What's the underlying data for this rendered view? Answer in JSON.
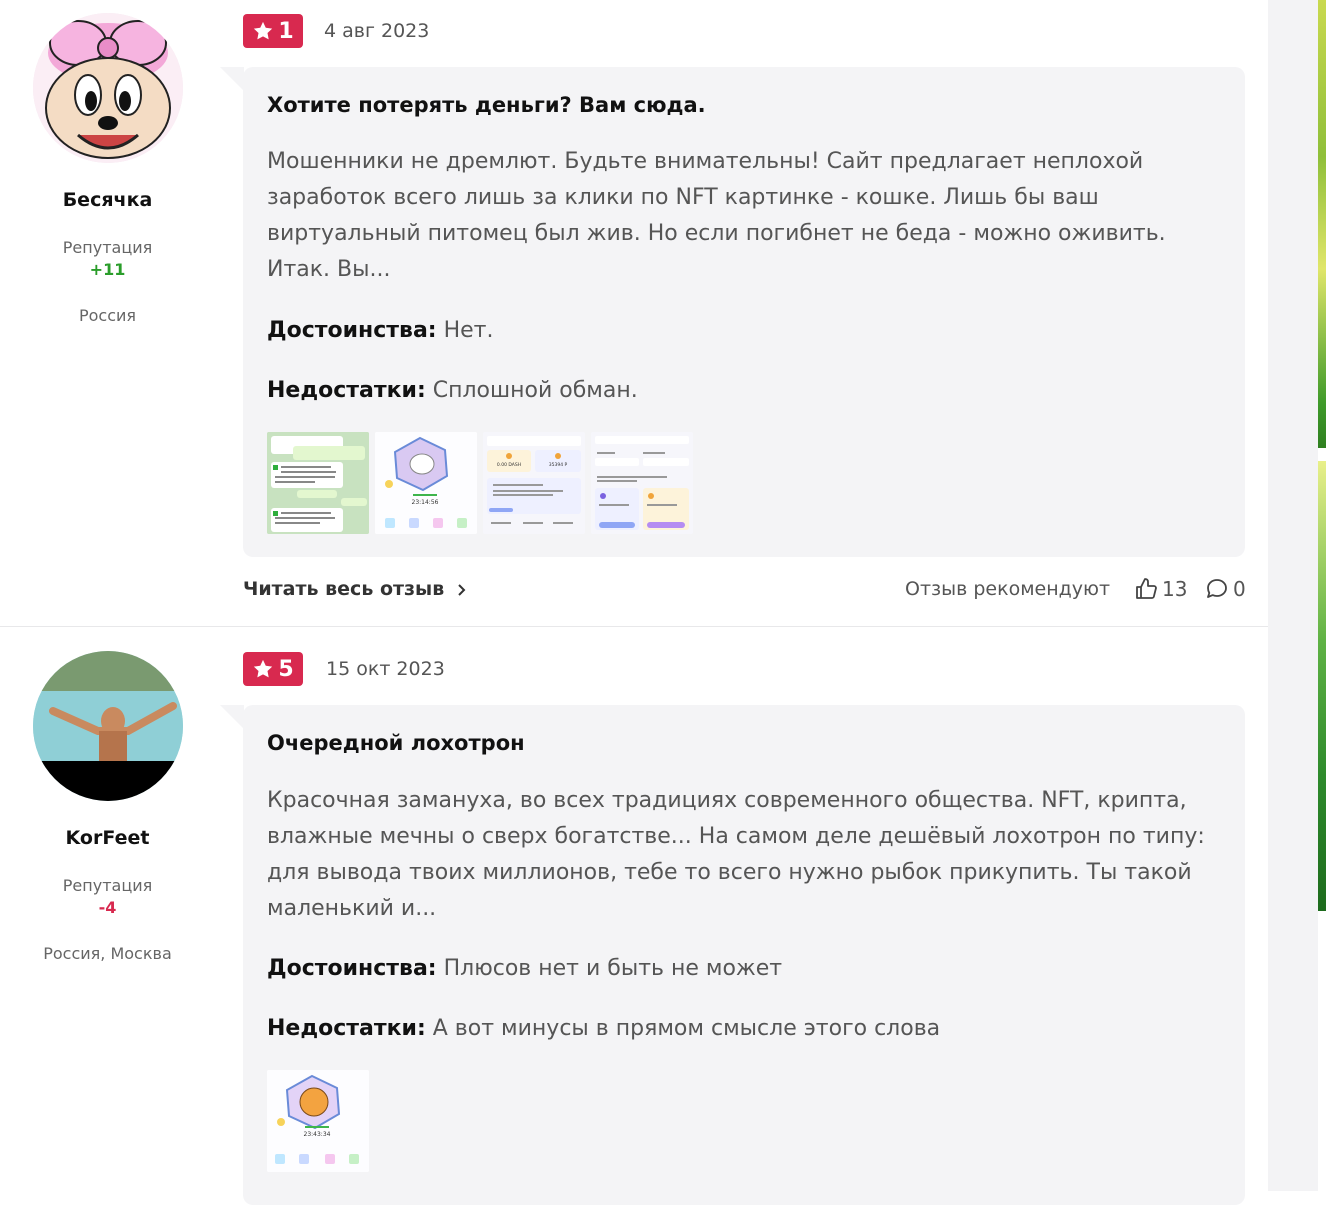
{
  "reviews": [
    {
      "author": {
        "name": "Бесячка",
        "reputation_label": "Репутация",
        "reputation_value": "+11",
        "reputation_color": "#2a9d2a",
        "location": "Россия"
      },
      "rating": "1",
      "date": "4 авг 2023",
      "title": "Хотите потерять деньги? Вам сюда.",
      "text": "Мошенники не дремлют. Будьте внимательны! Сайт предлагает неплохой заработок всего лишь за клики по NFT картинке - кошке. Лишь бы ваш виртуальный питомец был жив. Но если погибнет не беда - можно оживить. Итак. Вы...",
      "pros_label": "Достоинства:",
      "pros": "Нет.",
      "cons_label": "Недостатки:",
      "cons": "Сплошной обман.",
      "thumb_1_time": "23:14:56",
      "thumb_2_amounts": [
        "0.00 DASH",
        "35394 P"
      ],
      "read_more": "Читать весь отзыв",
      "recommend": "Отзыв рекомендуют",
      "likes": "13",
      "comments": "0"
    },
    {
      "author": {
        "name": "KorFeet",
        "reputation_label": "Репутация",
        "reputation_value": "-4",
        "reputation_color": "#d8294f",
        "location": "Россия, Москва"
      },
      "rating": "5",
      "date": "15 окт 2023",
      "title": "Очередной лохотрон",
      "text": "Красочная замануха, во всех традициях современного общества. NFT, крипта, влажные мечны о сверх богатстве... На самом деле дешёвый лохотрон по типу: для вывода твоих миллионов, тебе то всего нужно рыбок прикупить. Ты такой маленький и...",
      "pros_label": "Достоинства:",
      "pros": "Плюсов нет и быть не может",
      "cons_label": "Недостатки:",
      "cons": "А вот минусы в прямом смысле этого слова",
      "thumb_time": "23:43:34"
    }
  ],
  "colors": {
    "accent": "#d8294f",
    "card_bg": "#f4f4f6"
  },
  "icons": [
    "star-icon",
    "chevron-right-icon",
    "thumbs-up-icon",
    "comment-icon"
  ]
}
